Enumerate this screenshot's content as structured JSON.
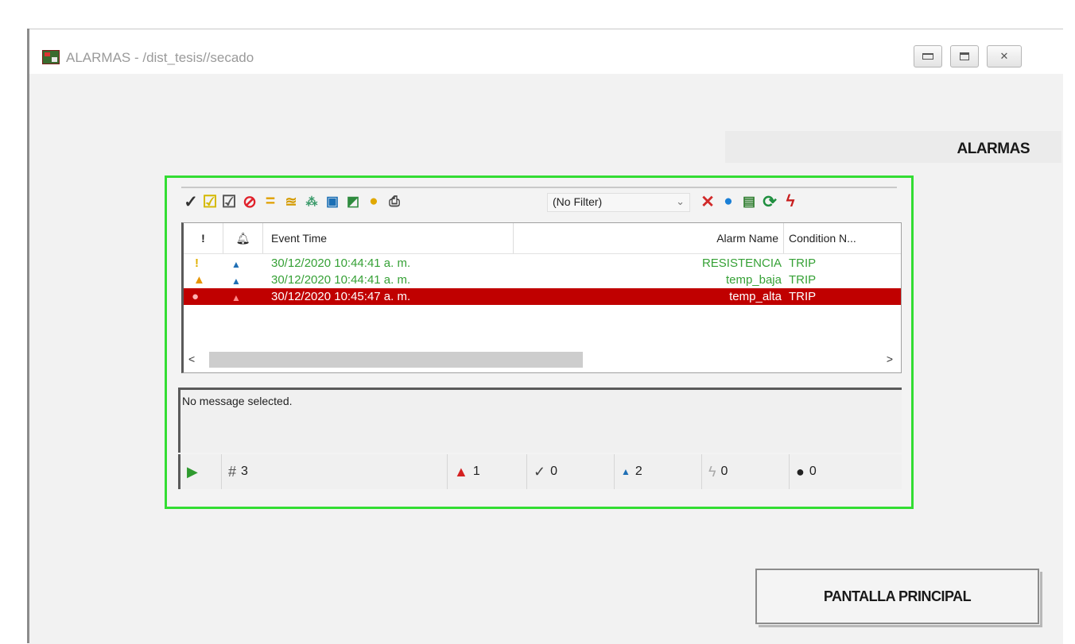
{
  "window": {
    "title": "ALARMAS - /dist_tesis//secado"
  },
  "header": {
    "label": "ALARMAS"
  },
  "toolbar": {
    "icons": [
      "ack-icon",
      "ack-selected-icon",
      "ack-all-icon",
      "disable-icon",
      "equals-icon",
      "sort-icon",
      "find-icon",
      "export-icon",
      "config-icon",
      "help-icon",
      "print-icon",
      "clear-filter-icon",
      "globe-icon",
      "save-icon",
      "refresh-icon",
      "lightning-icon"
    ],
    "filter_value": "(No Filter)"
  },
  "list": {
    "columns": [
      "!",
      "Event Time",
      "Alarm Name",
      "Condition N..."
    ],
    "rows": [
      {
        "time": "30/12/2020 10:44:41 a. m.",
        "name": "RESISTENCIA",
        "condition": "TRIP",
        "severity": "warning"
      },
      {
        "time": "30/12/2020 10:44:41 a. m.",
        "name": "temp_baja",
        "condition": "TRIP",
        "severity": "warning"
      },
      {
        "time": "30/12/2020 10:45:47 a. m.",
        "name": "temp_alta",
        "condition": "TRIP",
        "severity": "critical"
      }
    ]
  },
  "message": {
    "text": "No message selected."
  },
  "status": {
    "total": "3",
    "active_alarms": "1",
    "acked": "0",
    "normal": "2",
    "shelved": "0",
    "unknown": "0"
  },
  "buttons": {
    "main": "PANTALLA PRINCIPAL"
  },
  "colors": {
    "frame": "#33dd33",
    "selected_row": "#c00000",
    "row_text": "#36a136"
  }
}
